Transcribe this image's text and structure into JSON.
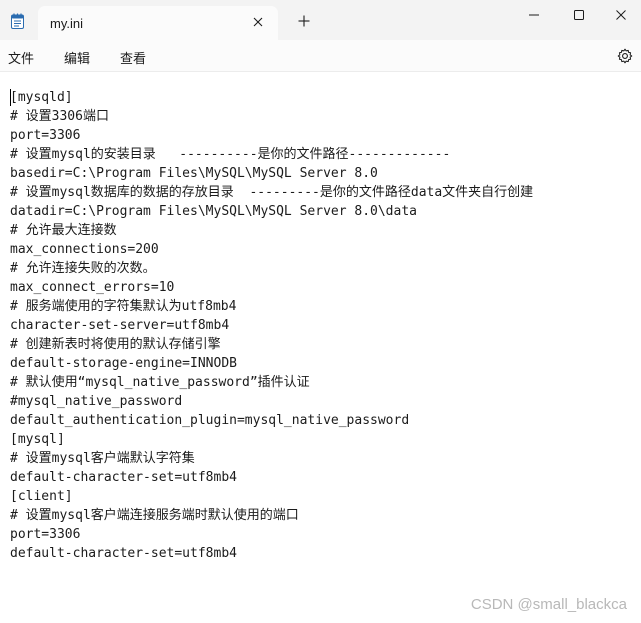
{
  "tab": {
    "title": "my.ini",
    "close_glyph": "✕",
    "new_tab_glyph": "+",
    "icon": "notepad-icon"
  },
  "window_controls": {
    "minimize_icon": "minimize-icon",
    "maximize_icon": "maximize-icon",
    "close_icon": "close-icon"
  },
  "menu": {
    "file_label": "文件",
    "edit_label": "编辑",
    "view_label": "查看",
    "settings_icon": "gear-icon"
  },
  "editor": {
    "lines": [
      "[mysqld]",
      "# 设置3306端口",
      "port=3306",
      "# 设置mysql的安装目录   ----------是你的文件路径-------------",
      "basedir=C:\\Program Files\\MySQL\\MySQL Server 8.0",
      "# 设置mysql数据库的数据的存放目录  ---------是你的文件路径data文件夹自行创建",
      "datadir=C:\\Program Files\\MySQL\\MySQL Server 8.0\\data",
      "# 允许最大连接数",
      "max_connections=200",
      "# 允许连接失败的次数。",
      "max_connect_errors=10",
      "# 服务端使用的字符集默认为utf8mb4",
      "character-set-server=utf8mb4",
      "# 创建新表时将使用的默认存储引擎",
      "default-storage-engine=INNODB",
      "# 默认使用“mysql_native_password”插件认证",
      "#mysql_native_password",
      "default_authentication_plugin=mysql_native_password",
      "[mysql]",
      "# 设置mysql客户端默认字符集",
      "default-character-set=utf8mb4",
      "[client]",
      "# 设置mysql客户端连接服务端时默认使用的端口",
      "port=3306",
      "default-character-set=utf8mb4"
    ]
  },
  "watermark": "CSDN @small_blackca",
  "colors": {
    "tabbar_bg": "#f3f3f3",
    "active_tab_bg": "#fbfbfb",
    "editor_bg": "#ffffff",
    "text": "#1b1b1b",
    "watermark": "#b8b8b8",
    "app_icon_accent": "#2b6cb0"
  }
}
